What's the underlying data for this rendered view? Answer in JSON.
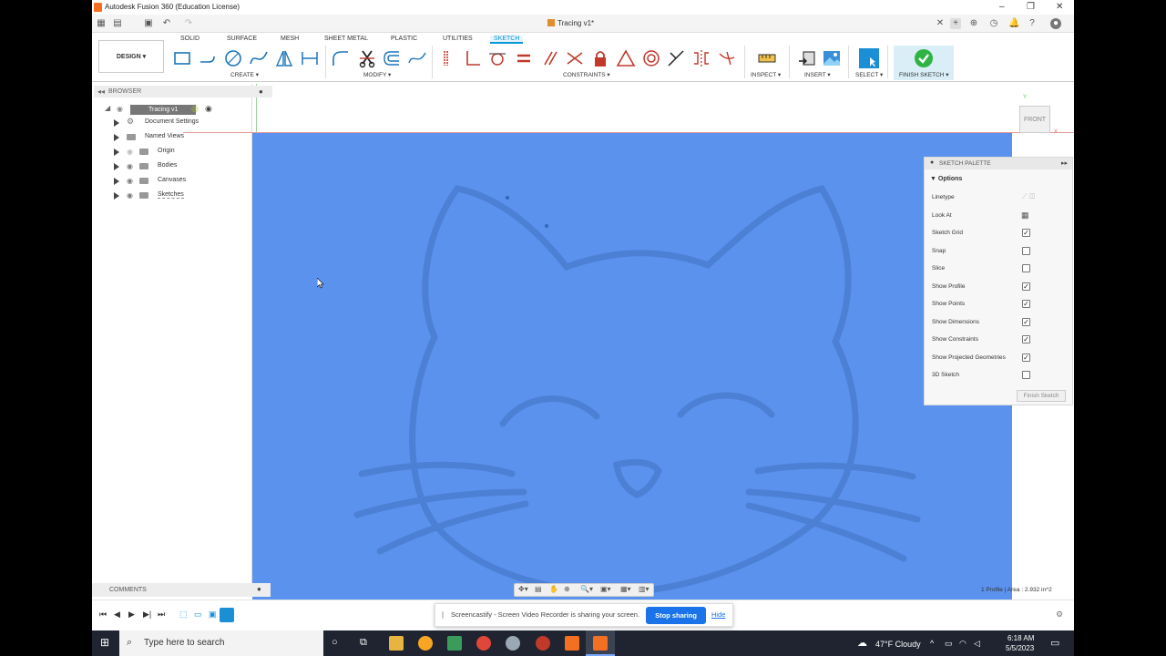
{
  "window": {
    "title": "Autodesk Fusion 360 (Education License)",
    "controls": [
      "–",
      "❐",
      "✕"
    ]
  },
  "doc_tab": {
    "name": "Tracing v1*"
  },
  "ribbon": {
    "workspace": "DESIGN ▾",
    "tabs": [
      "SOLID",
      "SURFACE",
      "MESH",
      "SHEET METAL",
      "PLASTIC",
      "UTILITIES",
      "SKETCH"
    ],
    "active_tab": "SKETCH",
    "groups": {
      "create": "CREATE ▾",
      "modify": "MODIFY ▾",
      "constraints": "CONSTRAINTS ▾",
      "inspect": "INSPECT ▾",
      "insert": "INSERT ▾",
      "select": "SELECT ▾",
      "finish": "FINISH SKETCH ▾"
    }
  },
  "browser": {
    "title": "BROWSER",
    "root": "Tracing v1",
    "items": [
      {
        "label": "Document Settings",
        "icon": "gear-icon"
      },
      {
        "label": "Named Views",
        "icon": "folder-icon"
      },
      {
        "label": "Origin",
        "icon": "folder-icon"
      },
      {
        "label": "Bodies",
        "icon": "folder-icon"
      },
      {
        "label": "Canvases",
        "icon": "folder-icon"
      },
      {
        "label": "Sketches",
        "icon": "folder-icon"
      }
    ]
  },
  "viewcube": {
    "face": "FRONT"
  },
  "sketch_palette": {
    "title": "SKETCH PALETTE",
    "section": "Options",
    "options": [
      {
        "label": "Linetype",
        "type": "icons"
      },
      {
        "label": "Look At",
        "type": "icon"
      },
      {
        "label": "Sketch Grid",
        "checked": true
      },
      {
        "label": "Snap",
        "checked": false
      },
      {
        "label": "Slice",
        "checked": false
      },
      {
        "label": "Show Profile",
        "checked": true
      },
      {
        "label": "Show Points",
        "checked": true
      },
      {
        "label": "Show Dimensions",
        "checked": true
      },
      {
        "label": "Show Constraints",
        "checked": true
      },
      {
        "label": "Show Projected Geometries",
        "checked": true
      },
      {
        "label": "3D Sketch",
        "checked": false
      }
    ],
    "finish_button": "Finish Sketch"
  },
  "comments": {
    "title": "COMMENTS"
  },
  "status": {
    "text": "1 Profile | Area : 2.932 in^2"
  },
  "share_banner": {
    "text": "Screencastify - Screen Video Recorder is sharing your screen.",
    "stop": "Stop sharing",
    "hide": "Hide"
  },
  "taskbar": {
    "search_placeholder": "Type here to search",
    "weather": "47°F  Cloudy",
    "time": "6:18 AM",
    "date": "5/5/2023"
  },
  "colors": {
    "canvas_blue": "#5b92ed",
    "accent": "#0696d7",
    "finish_green": "#2fb344"
  }
}
